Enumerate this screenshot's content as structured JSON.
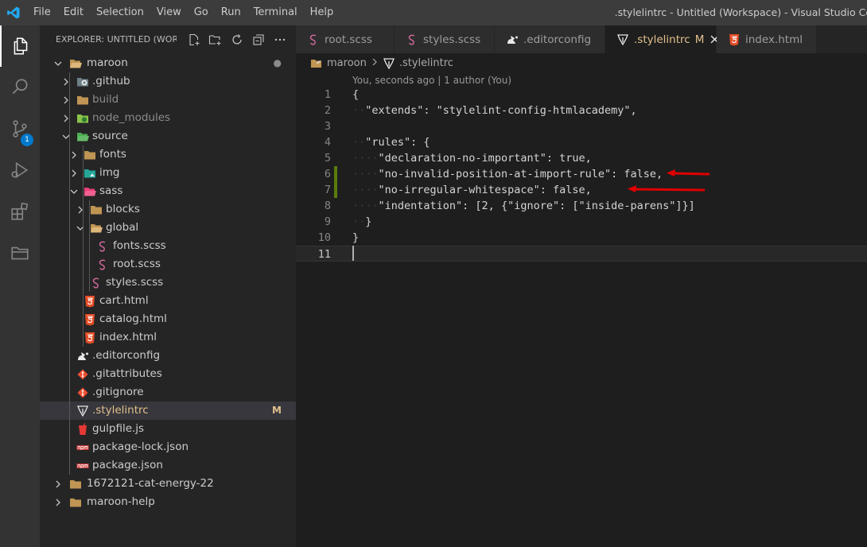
{
  "menu": [
    "File",
    "Edit",
    "Selection",
    "View",
    "Go",
    "Run",
    "Terminal",
    "Help"
  ],
  "window_title": ".stylelintrc - Untitled (Workspace) - Visual Studio Co",
  "activity": {
    "scm_badge": "1"
  },
  "explorer": {
    "title": "EXPLORER: UNTITLED (WOR...",
    "tree": [
      {
        "label": "maroon",
        "depth": 0,
        "type": "folder",
        "open": true,
        "icon": "folder-open-icon",
        "mark": "●",
        "mark_color": "#8b8b8b"
      },
      {
        "label": ".github",
        "depth": 1,
        "type": "folder",
        "open": false,
        "icon": "github-folder-icon"
      },
      {
        "label": "build",
        "depth": 1,
        "type": "folder",
        "open": false,
        "icon": "folder-icon",
        "dim": true
      },
      {
        "label": "node_modules",
        "depth": 1,
        "type": "folder",
        "open": false,
        "icon": "node-folder-icon",
        "dim": true
      },
      {
        "label": "source",
        "depth": 1,
        "type": "folder",
        "open": true,
        "icon": "source-folder-icon"
      },
      {
        "label": "fonts",
        "depth": 2,
        "type": "folder",
        "open": false,
        "icon": "folder-icon"
      },
      {
        "label": "img",
        "depth": 2,
        "type": "folder",
        "open": false,
        "icon": "image-folder-icon"
      },
      {
        "label": "sass",
        "depth": 2,
        "type": "folder",
        "open": true,
        "icon": "sass-folder-icon"
      },
      {
        "label": "blocks",
        "depth": 3,
        "type": "folder",
        "open": false,
        "icon": "folder-icon"
      },
      {
        "label": "global",
        "depth": 3,
        "type": "folder",
        "open": true,
        "icon": "folder-open-icon"
      },
      {
        "label": "fonts.scss",
        "depth": 4,
        "type": "file",
        "icon": "sass-file-icon"
      },
      {
        "label": "root.scss",
        "depth": 4,
        "type": "file",
        "icon": "sass-file-icon"
      },
      {
        "label": "styles.scss",
        "depth": 3,
        "type": "file",
        "icon": "sass-file-icon"
      },
      {
        "label": "cart.html",
        "depth": 2,
        "type": "file",
        "icon": "html-file-icon"
      },
      {
        "label": "catalog.html",
        "depth": 2,
        "type": "file",
        "icon": "html-file-icon"
      },
      {
        "label": "index.html",
        "depth": 2,
        "type": "file",
        "icon": "html-file-icon"
      },
      {
        "label": ".editorconfig",
        "depth": 1,
        "type": "file",
        "icon": "editorconfig-file-icon"
      },
      {
        "label": ".gitattributes",
        "depth": 1,
        "type": "file",
        "icon": "git-file-icon"
      },
      {
        "label": ".gitignore",
        "depth": 1,
        "type": "file",
        "icon": "git-file-icon"
      },
      {
        "label": ".stylelintrc",
        "depth": 1,
        "type": "file",
        "icon": "stylelint-file-icon",
        "selected": true,
        "modified": true,
        "mark": "M",
        "mark_color": "#e2c08d"
      },
      {
        "label": "gulpfile.js",
        "depth": 1,
        "type": "file",
        "icon": "gulp-file-icon"
      },
      {
        "label": "package-lock.json",
        "depth": 1,
        "type": "file",
        "icon": "npm-file-icon"
      },
      {
        "label": "package.json",
        "depth": 1,
        "type": "file",
        "icon": "npm-file-icon"
      },
      {
        "label": "1672121-cat-energy-22",
        "depth": 0,
        "type": "folder",
        "open": false,
        "icon": "folder-icon"
      },
      {
        "label": "maroon-help",
        "depth": 0,
        "type": "folder",
        "open": false,
        "icon": "folder-icon"
      }
    ]
  },
  "tabs": [
    {
      "label": "root.scss",
      "icon": "sass-file-icon"
    },
    {
      "label": "styles.scss",
      "icon": "sass-file-icon"
    },
    {
      "label": ".editorconfig",
      "icon": "editorconfig-file-icon"
    },
    {
      "label": ".stylelintrc",
      "icon": "stylelint-file-icon",
      "active": true,
      "mark": "M"
    },
    {
      "label": "index.html",
      "icon": "html-file-icon"
    }
  ],
  "breadcrumb": {
    "folder": "maroon",
    "file": ".stylelintrc"
  },
  "editor": {
    "codelens": "You, seconds ago | 1 author (You)",
    "current_line": 11,
    "lines": [
      {
        "n": "1",
        "ws": "",
        "text": "{"
      },
      {
        "n": "2",
        "ws": "··",
        "text": "\"extends\": \"stylelint-config-htmlacademy\","
      },
      {
        "n": "3",
        "ws": "",
        "text": ""
      },
      {
        "n": "4",
        "ws": "··",
        "text": "\"rules\": {"
      },
      {
        "n": "5",
        "ws": "····",
        "text": "\"declaration-no-important\": true,"
      },
      {
        "n": "6",
        "ws": "····",
        "text": "\"no-invalid-position-at-import-rule\": false,",
        "changed": true
      },
      {
        "n": "7",
        "ws": "····",
        "text": "\"no-irregular-whitespace\": false,",
        "changed": true
      },
      {
        "n": "8",
        "ws": "····",
        "text": "\"indentation\": [2, {\"ignore\": [\"inside-parens\"]}]"
      },
      {
        "n": "9",
        "ws": "··",
        "text": "}"
      },
      {
        "n": "10",
        "ws": "",
        "text": "}"
      },
      {
        "n": "11",
        "ws": "",
        "text": ""
      }
    ]
  },
  "colors": {
    "accent": "#007acc",
    "modified": "#e2c08d",
    "added_gutter": "#587c0c",
    "annotation_arrow": "#e00000"
  }
}
